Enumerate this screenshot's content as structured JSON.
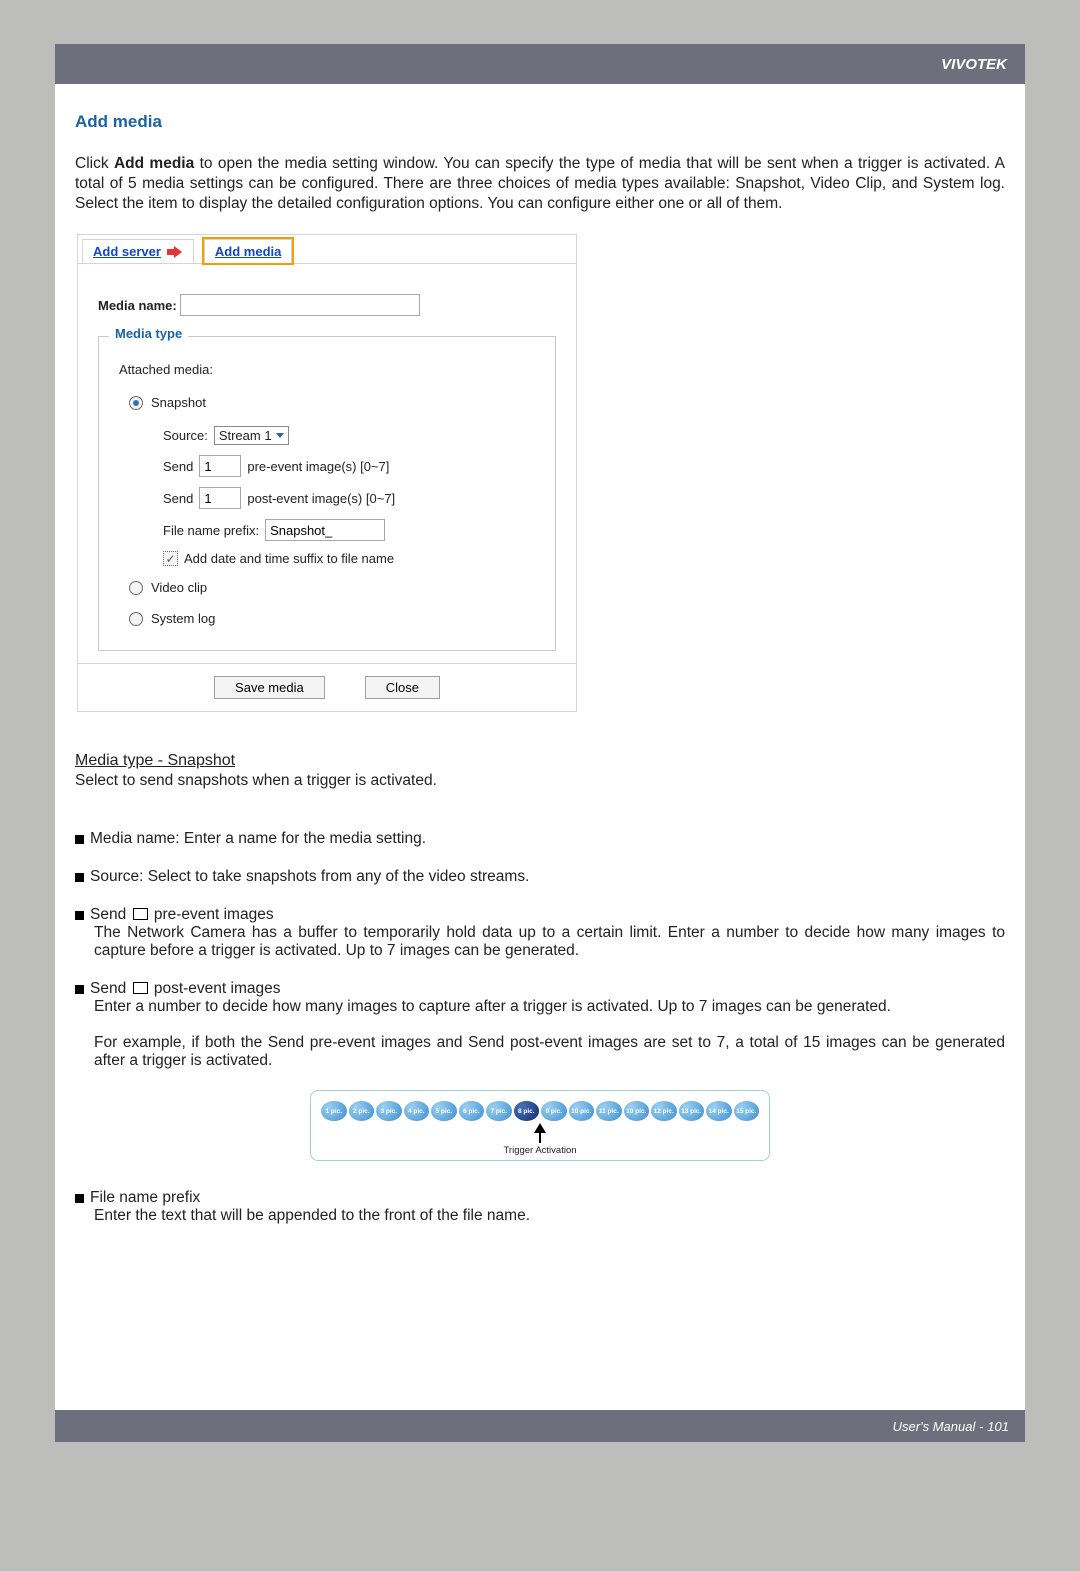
{
  "header": {
    "brand": "VIVOTEK"
  },
  "section_title": "Add media",
  "intro": {
    "prefix": "Click ",
    "link": "Add media",
    "rest": " to open the media setting window. You can specify the type of media that will be sent when a trigger is activated. A total of 5 media settings can be configured. There are three choices of media types available: Snapshot, Video Clip, and System log. Select the item to display the detailed configuration options. You can configure either one or all of them."
  },
  "dialog": {
    "tabs": {
      "add_server": "Add server",
      "add_media": "Add media"
    },
    "media_name_label": "Media name:",
    "media_name_value": "",
    "media_type_legend": "Media type",
    "attached_label": "Attached media:",
    "radio": {
      "snapshot": "Snapshot",
      "video_clip": "Video clip",
      "system_log": "System log"
    },
    "source_label": "Source:",
    "source_value": "Stream 1",
    "send_label": "Send",
    "pre_value": "1",
    "pre_suffix": "pre-event image(s) [0~7]",
    "post_value": "1",
    "post_suffix": "post-event image(s) [0~7]",
    "prefix_label": "File name prefix:",
    "prefix_value": "Snapshot_",
    "suffix_checkbox": "Add date and time suffix to file name",
    "buttons": {
      "save": "Save media",
      "close": "Close"
    }
  },
  "snapshot_section": {
    "heading": "Media type - Snapshot",
    "line": "Select to send snapshots when a trigger is activated."
  },
  "bullets": {
    "media_name": "Media name: Enter a name for the media setting.",
    "source": "Source: Select to take snapshots from any of the video streams.",
    "pre": {
      "lead_a": "Send ",
      "lead_b": " pre-event images",
      "detail": "The Network Camera has a buffer to temporarily hold data up to a certain limit. Enter a number to decide how many images to capture before a trigger is activated. Up to 7 images can be generated."
    },
    "post": {
      "lead_a": "Send ",
      "lead_b": " post-event images",
      "detail": "Enter a number to decide how many images to capture after a trigger is activated. Up to 7 images can be generated.",
      "example": "For example, if both the Send pre-event images and Send post-event images are set to 7, a total of 15 images can be generated after a trigger is activated."
    },
    "prefix": {
      "lead": "File name prefix",
      "detail": "Enter the text that will be appended to the front of the file name."
    }
  },
  "pics": [
    "1 pic.",
    "2 pic.",
    "3 pic.",
    "4 pic.",
    "5 pic.",
    "6 pic.",
    "7 pic.",
    "8 pic.",
    "9 pic.",
    "10 pic.",
    "11 pic.",
    "10 pic.",
    "12 pic.",
    "13 pic.",
    "14 pic.",
    "15 pic."
  ],
  "trigger_label": "Trigger Activation",
  "footer": {
    "text": "User's Manual - ",
    "page": "101"
  }
}
